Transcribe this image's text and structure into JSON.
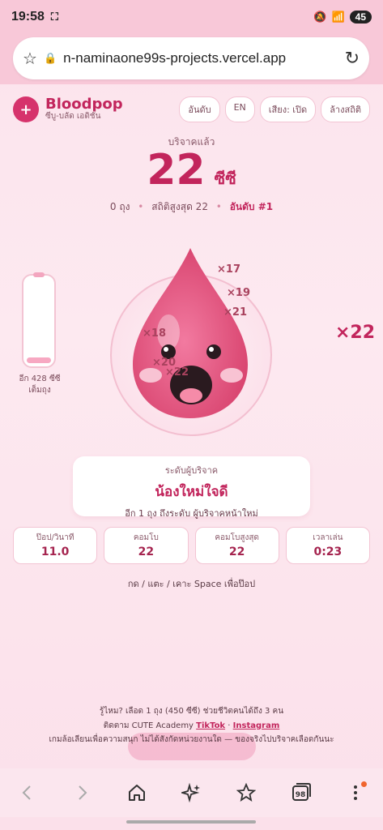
{
  "status": {
    "time": "19:58",
    "battery": "45"
  },
  "browser": {
    "url": "n-naminaone99s-projects.vercel.app"
  },
  "app": {
    "name": "Bloodpop",
    "subtitle": "ซีบู-บลัด เอดิชั่น",
    "buttons": {
      "rank": "อันดับ",
      "lang": "EN",
      "sound": "เสียง: เปิด",
      "reset": "ล้างสถิติ"
    }
  },
  "score": {
    "label": "บริจาคแล้ว",
    "value": "22",
    "unit": "ซีซี",
    "bags": "0 ถุง",
    "best": "สถิติสูงสุด 22",
    "rank": "อันดับ #1"
  },
  "bag": {
    "line1": "อีก 428 ซีซี",
    "line2": "เต็มถุง",
    "fill_fraction": 0.05
  },
  "combo_floats": [
    "×17",
    "×19",
    "×21",
    "×18",
    "×20",
    "×22"
  ],
  "combo_big": "×22",
  "level": {
    "label": "ระดับผู้บริจาค",
    "name": "น้องใหม่ใจดี",
    "next": "อีก 1 ถุง ถึงระดับ ผู้บริจาคหน้าใหม่"
  },
  "stats": [
    {
      "label": "ป๊อป/วินาที",
      "value": "11.0"
    },
    {
      "label": "คอมโบ",
      "value": "22"
    },
    {
      "label": "คอมโบสูงสุด",
      "value": "22"
    },
    {
      "label": "เวลาเล่น",
      "value": "0:23"
    }
  ],
  "hint": "กด / แตะ / เคาะ Space เพื่อป๊อป",
  "footer": {
    "fact": "รู้ไหม? เลือด 1 ถุง (450 ซีซี) ช่วยชีวิตคนได้ถึง 3 คน",
    "follow": "ติดตาม CUTE Academy",
    "tiktok": "TikTok",
    "sep": "·",
    "instagram": "Instagram",
    "disclaimer": "เกมล้อเลียนเพื่อความสนุก ไม่ได้สังกัดหน่วยงานใด — ของจริงไปบริจาคเลือดกันนะ"
  },
  "colors": {
    "accent": "#c2255c",
    "drop": "#e35d86"
  }
}
